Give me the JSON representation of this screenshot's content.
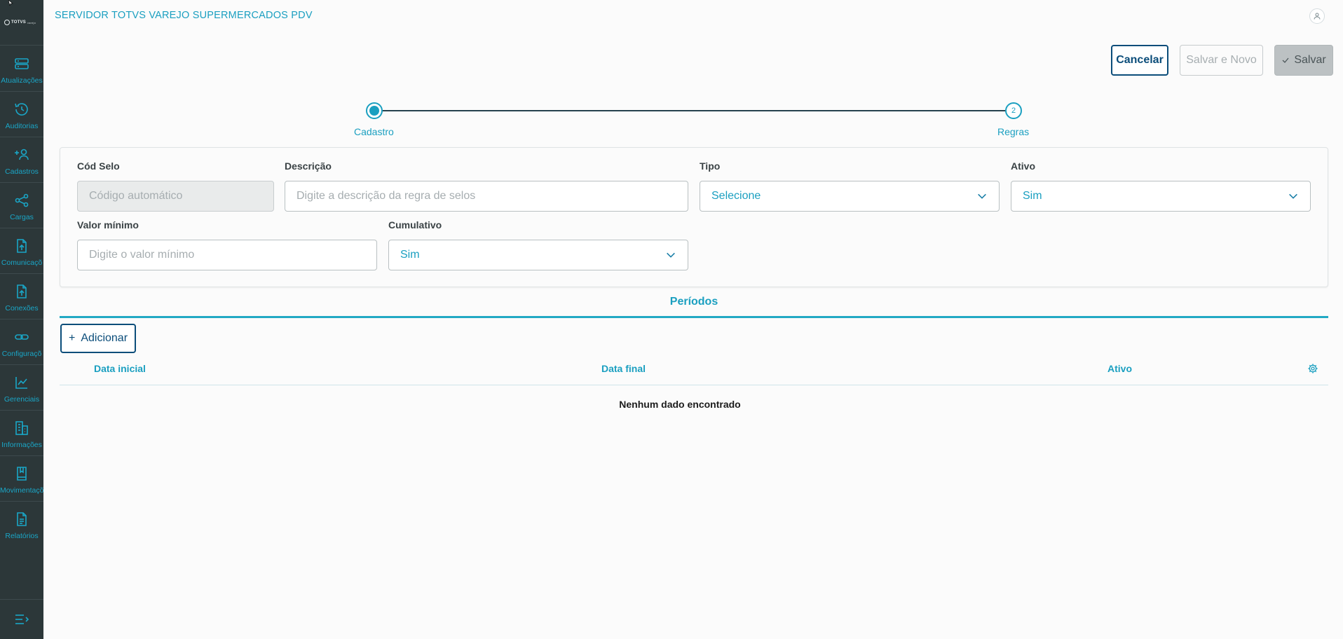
{
  "header": {
    "title": "SERVIDOR TOTVS VAREJO SUPERMERCADOS PDV",
    "logo_text": "TOTVS",
    "logo_subtext": "varejo"
  },
  "sidebar": {
    "items": [
      {
        "label": "Atualizações",
        "icon": "server-icon"
      },
      {
        "label": "Auditorias",
        "icon": "history-icon"
      },
      {
        "label": "Cadastros",
        "icon": "user-add-icon"
      },
      {
        "label": "Cargas",
        "icon": "share-icon"
      },
      {
        "label": "Comunicaçõ",
        "icon": "file-upload-icon"
      },
      {
        "label": "Conexões",
        "icon": "file-upload-icon"
      },
      {
        "label": "Configuraçõ",
        "icon": "link-icon"
      },
      {
        "label": "Gerenciais",
        "icon": "chart-icon"
      },
      {
        "label": "Informações",
        "icon": "building-icon"
      },
      {
        "label": "Movimentaçõ",
        "icon": "book-icon"
      },
      {
        "label": "Relatórios",
        "icon": "document-icon"
      }
    ]
  },
  "actions": {
    "cancel": "Cancelar",
    "save_new": "Salvar e Novo",
    "save": "Salvar"
  },
  "stepper": {
    "step1": {
      "label": "Cadastro",
      "number": ""
    },
    "step2": {
      "label": "Regras",
      "number": "2"
    }
  },
  "form": {
    "cod_selo": {
      "label": "Cód Selo",
      "placeholder": "Código automático"
    },
    "descricao": {
      "label": "Descrição",
      "placeholder": "Digite a descrição da regra de selos"
    },
    "tipo": {
      "label": "Tipo",
      "value": "Selecione"
    },
    "ativo": {
      "label": "Ativo",
      "value": "Sim"
    },
    "valor_minimo": {
      "label": "Valor mínimo",
      "placeholder": "Digite o valor mínimo"
    },
    "cumulativo": {
      "label": "Cumulativo",
      "value": "Sim"
    }
  },
  "periods": {
    "tab": "Períodos",
    "add_button": "Adicionar",
    "columns": [
      "Data inicial",
      "Data final",
      "Ativo"
    ],
    "empty_text": "Nenhum dado encontrado"
  },
  "colors": {
    "sidebar_bg": "#2c3739",
    "accent": "#1a9fc0",
    "primary_dark": "#0b4d7a"
  }
}
